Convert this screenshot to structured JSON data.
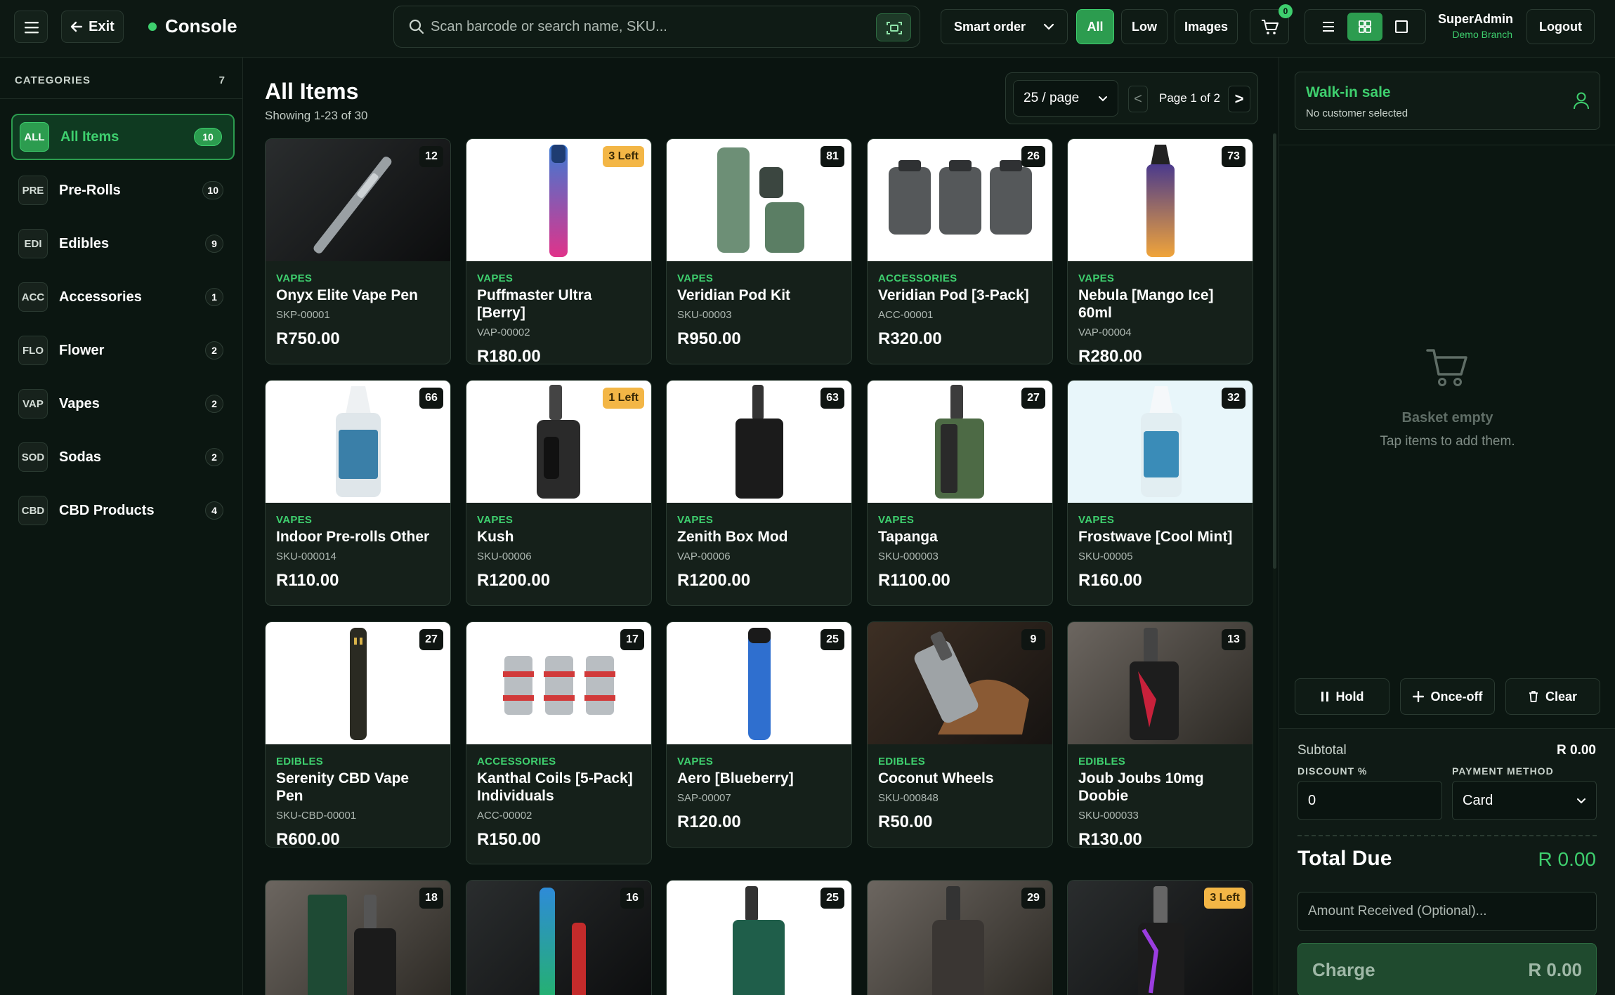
{
  "topbar": {
    "exit_label": "Exit",
    "brand": "Console",
    "search_placeholder": "Scan barcode or search name, SKU...",
    "sort_label": "Smart order",
    "filters": {
      "all": "All",
      "low": "Low",
      "images": "Images"
    },
    "cart_count": "0",
    "user_name": "SuperAdmin",
    "user_branch": "Demo Branch",
    "logout_label": "Logout"
  },
  "sidebar": {
    "header": "CATEGORIES",
    "header_count": "7",
    "items": [
      {
        "abbr": "ALL",
        "label": "All Items",
        "count": "10"
      },
      {
        "abbr": "PRE",
        "label": "Pre-Rolls",
        "count": "10"
      },
      {
        "abbr": "EDI",
        "label": "Edibles",
        "count": "9"
      },
      {
        "abbr": "ACC",
        "label": "Accessories",
        "count": "1"
      },
      {
        "abbr": "FLO",
        "label": "Flower",
        "count": "2"
      },
      {
        "abbr": "VAP",
        "label": "Vapes",
        "count": "2"
      },
      {
        "abbr": "SOD",
        "label": "Sodas",
        "count": "2"
      },
      {
        "abbr": "CBD",
        "label": "CBD Products",
        "count": "4"
      }
    ]
  },
  "main": {
    "title": "All Items",
    "subtitle": "Showing 1-23 of 30",
    "per_page": "25 / page",
    "prev": "<",
    "page_label": "Page 1 of 2",
    "next": ">"
  },
  "products": [
    {
      "category": "VAPES",
      "name": "Onyx Elite Vape Pen",
      "sku": "SKP-00001",
      "price": "R750.00",
      "stock": "12",
      "low": false
    },
    {
      "category": "VAPES",
      "name": "Puffmaster Ultra [Berry]",
      "sku": "VAP-00002",
      "price": "R180.00",
      "stock": "3 Left",
      "low": true
    },
    {
      "category": "VAPES",
      "name": "Veridian Pod Kit",
      "sku": "SKU-00003",
      "price": "R950.00",
      "stock": "81",
      "low": false
    },
    {
      "category": "ACCESSORIES",
      "name": "Veridian Pod [3-Pack]",
      "sku": "ACC-00001",
      "price": "R320.00",
      "stock": "26",
      "low": false
    },
    {
      "category": "VAPES",
      "name": "Nebula [Mango Ice] 60ml",
      "sku": "VAP-00004",
      "price": "R280.00",
      "stock": "73",
      "low": false
    },
    {
      "category": "VAPES",
      "name": "Indoor Pre-rolls Other",
      "sku": "SKU-000014",
      "price": "R110.00",
      "stock": "66",
      "low": false
    },
    {
      "category": "VAPES",
      "name": "Kush",
      "sku": "SKU-00006",
      "price": "R1200.00",
      "stock": "1 Left",
      "low": true
    },
    {
      "category": "VAPES",
      "name": "Zenith Box Mod",
      "sku": "VAP-00006",
      "price": "R1200.00",
      "stock": "63",
      "low": false
    },
    {
      "category": "VAPES",
      "name": "Tapanga",
      "sku": "SKU-000003",
      "price": "R1100.00",
      "stock": "27",
      "low": false
    },
    {
      "category": "VAPES",
      "name": "Frostwave [Cool Mint]",
      "sku": "SKU-00005",
      "price": "R160.00",
      "stock": "32",
      "low": false
    },
    {
      "category": "EDIBLES",
      "name": "Serenity CBD Vape Pen",
      "sku": "SKU-CBD-00001",
      "price": "R600.00",
      "stock": "27",
      "low": false
    },
    {
      "category": "ACCESSORIES",
      "name": "Kanthal Coils [5-Pack] Individuals",
      "sku": "ACC-00002",
      "price": "R150.00",
      "stock": "17",
      "low": false
    },
    {
      "category": "VAPES",
      "name": "Aero [Blueberry]",
      "sku": "SAP-00007",
      "price": "R120.00",
      "stock": "25",
      "low": false
    },
    {
      "category": "EDIBLES",
      "name": "Coconut Wheels",
      "sku": "SKU-000848",
      "price": "R50.00",
      "stock": "9",
      "low": false
    },
    {
      "category": "EDIBLES",
      "name": "Joub Joubs 10mg Doobie",
      "sku": "SKU-000033",
      "price": "R130.00",
      "stock": "13",
      "low": false
    },
    {
      "stock": "18",
      "low": false
    },
    {
      "stock": "16",
      "low": false
    },
    {
      "stock": "25",
      "low": false
    },
    {
      "stock": "29",
      "low": false
    },
    {
      "stock": "3 Left",
      "low": true
    }
  ],
  "basket": {
    "customer_title": "Walk-in sale",
    "customer_sub": "No customer selected",
    "empty_title": "Basket empty",
    "empty_sub": "Tap items to add them.",
    "hold_label": "Hold",
    "onceoff_label": "Once-off",
    "clear_label": "Clear",
    "subtotal_label": "Subtotal",
    "subtotal_value": "R 0.00",
    "discount_label": "DISCOUNT %",
    "discount_value": "0",
    "payment_label": "PAYMENT METHOD",
    "payment_value": "Card",
    "total_label": "Total Due",
    "total_value": "R 0.00",
    "amount_placeholder": "Amount Received (Optional)...",
    "charge_label": "Charge",
    "charge_value": "R 0.00"
  },
  "colors": {
    "accent": "#3ecf6e",
    "accent_dark": "#2c9c4f",
    "low_stock": "#f3b646",
    "bg": "#0a1410"
  }
}
